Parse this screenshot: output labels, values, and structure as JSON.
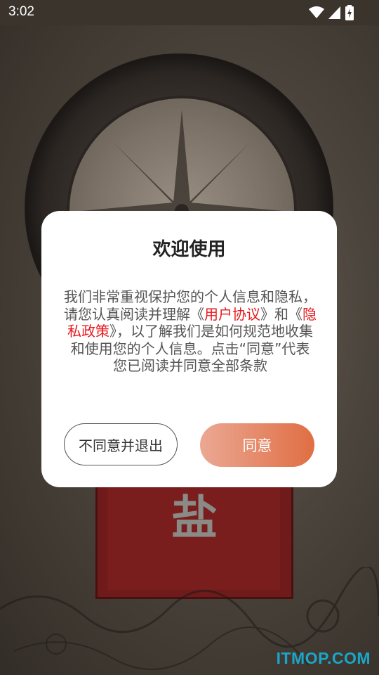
{
  "status_bar": {
    "time": "3:02",
    "icons": [
      "wifi-icon",
      "cellular-signal-icon",
      "battery-charging-icon"
    ]
  },
  "background": {
    "seal_character": "盐"
  },
  "dialog": {
    "title": "欢迎使用",
    "body": {
      "part1": "我们非常重视保护您的个人信息和隐私，请您认真阅读并理解《",
      "user_agreement_link": "用户协议",
      "part2": "》和《",
      "privacy_policy_link": "隐私政策",
      "part3": "》，以了解我们是如何规范地收集和使用您的个人信息。点击“同意”代表您已阅读并同意全部条款"
    },
    "disagree_button": "不同意并退出",
    "agree_button": "同意"
  },
  "watermark": "ITMOP.COM",
  "colors": {
    "link": "#e8181c",
    "agree_gradient_start": "#eba893",
    "agree_gradient_end": "#e06e43",
    "watermark": "#1aa6c9"
  }
}
